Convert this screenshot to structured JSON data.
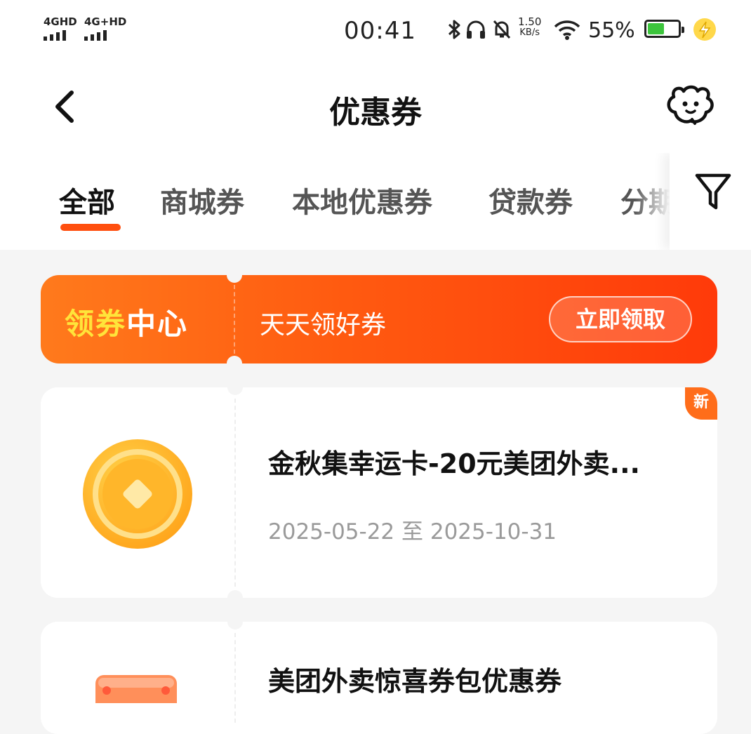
{
  "status_bar": {
    "sim1": "4GHD",
    "sim2": "4G+HD",
    "time": "00:41",
    "net_speed_value": "1.50",
    "net_speed_unit": "KB/s",
    "battery_text": "55%",
    "battery_level": 0.55
  },
  "header": {
    "title": "优惠券",
    "back_icon": "chevron-left-icon",
    "assistant_icon": "assistant-mascot-icon"
  },
  "tabs": {
    "items": [
      "全部",
      "商城券",
      "本地优惠券",
      "贷款券",
      "分期"
    ],
    "active_index": 0,
    "filter_icon": "filter-icon"
  },
  "banner": {
    "title_part1": "领券",
    "title_part2": "中心",
    "subtitle": "天天领好券",
    "button_label": "立即领取"
  },
  "coupons": [
    {
      "name": "金秋集幸运卡-20元美团外卖...",
      "dates": "2025-05-22 至 2025-10-31",
      "badge": "新",
      "icon": "gold-coin-icon"
    },
    {
      "name": "美团外卖惊喜券包优惠券",
      "dates": "",
      "badge": "",
      "icon": "coupon-pack-icon"
    }
  ],
  "colors": {
    "accent": "#ff4f0f",
    "banner_start": "#ff7a1c",
    "banner_end": "#ff3a0a",
    "banner_highlight": "#ffe43a",
    "background": "#f5f5f5"
  }
}
